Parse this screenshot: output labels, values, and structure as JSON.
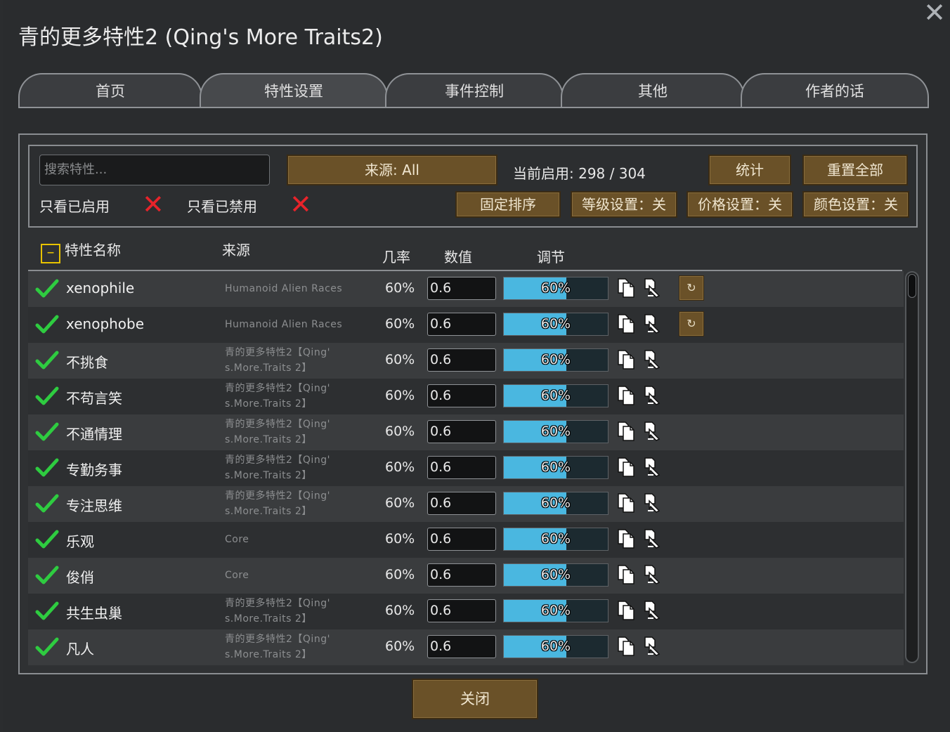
{
  "window": {
    "title": "青的更多特性2 (Qing's More Traits2)",
    "close_glyph": "✕"
  },
  "tabs": [
    {
      "label": "首页"
    },
    {
      "label": "特性设置"
    },
    {
      "label": "事件控制"
    },
    {
      "label": "其他"
    },
    {
      "label": "作者的话"
    }
  ],
  "active_tab": "特性设置",
  "toolbar": {
    "search_placeholder": "搜索特性...",
    "source_button": "来源: All",
    "enabled_count": "当前启用: 298 / 304",
    "stats_button": "统计",
    "reset_all_button": "重置全部",
    "only_enabled_label": "只看已启用",
    "only_disabled_label": "只看已禁用",
    "only_enabled_checked": false,
    "only_disabled_checked": false,
    "fixed_sort_button": "固定排序",
    "level_setting_button": "等级设置：关",
    "price_setting_button": "价格设置：关",
    "color_setting_button": "颜色设置：关"
  },
  "table": {
    "collapse_glyph": "–",
    "headers": {
      "name": "特性名称",
      "source": "来源",
      "rate": "几率",
      "value": "数值",
      "adjust": "调节"
    },
    "rows": [
      {
        "name": "xenophile",
        "source": [
          "Humanoid Alien Races"
        ],
        "rate": "60%",
        "value": "0.6",
        "progress": 0.6,
        "progress_label": "60%",
        "reset": true,
        "enabled": true
      },
      {
        "name": "xenophobe",
        "source": [
          "Humanoid Alien Races"
        ],
        "rate": "60%",
        "value": "0.6",
        "progress": 0.6,
        "progress_label": "60%",
        "reset": true,
        "enabled": true
      },
      {
        "name": "不挑食",
        "source": [
          "青的更多特性2【Qing'",
          "s.More.Traits 2】"
        ],
        "rate": "60%",
        "value": "0.6",
        "progress": 0.6,
        "progress_label": "60%",
        "reset": false,
        "enabled": true
      },
      {
        "name": "不苟言笑",
        "source": [
          "青的更多特性2【Qing'",
          "s.More.Traits 2】"
        ],
        "rate": "60%",
        "value": "0.6",
        "progress": 0.6,
        "progress_label": "60%",
        "reset": false,
        "enabled": true
      },
      {
        "name": "不通情理",
        "source": [
          "青的更多特性2【Qing'",
          "s.More.Traits 2】"
        ],
        "rate": "60%",
        "value": "0.6",
        "progress": 0.6,
        "progress_label": "60%",
        "reset": false,
        "enabled": true
      },
      {
        "name": "专勤务事",
        "source": [
          "青的更多特性2【Qing'",
          "s.More.Traits 2】"
        ],
        "rate": "60%",
        "value": "0.6",
        "progress": 0.6,
        "progress_label": "60%",
        "reset": false,
        "enabled": true
      },
      {
        "name": "专注思维",
        "source": [
          "青的更多特性2【Qing'",
          "s.More.Traits 2】"
        ],
        "rate": "60%",
        "value": "0.6",
        "progress": 0.6,
        "progress_label": "60%",
        "reset": false,
        "enabled": true
      },
      {
        "name": "乐观",
        "source": [
          "Core"
        ],
        "rate": "60%",
        "value": "0.6",
        "progress": 0.6,
        "progress_label": "60%",
        "reset": false,
        "enabled": true
      },
      {
        "name": "俊俏",
        "source": [
          "Core"
        ],
        "rate": "60%",
        "value": "0.6",
        "progress": 0.6,
        "progress_label": "60%",
        "reset": false,
        "enabled": true
      },
      {
        "name": "共生虫巢",
        "source": [
          "青的更多特性2【Qing'",
          "s.More.Traits 2】"
        ],
        "rate": "60%",
        "value": "0.6",
        "progress": 0.6,
        "progress_label": "60%",
        "reset": false,
        "enabled": true
      },
      {
        "name": "凡人",
        "source": [
          "青的更多特性2【Qing'",
          "s.More.Traits 2】"
        ],
        "rate": "60%",
        "value": "0.6",
        "progress": 0.6,
        "progress_label": "60%",
        "reset": false,
        "enabled": true
      }
    ],
    "reset_glyph": "↻"
  },
  "footer": {
    "close_button": "关闭"
  },
  "colors": {
    "accent_blue": "#4ab7e0",
    "button_brown": "#6a5128",
    "check_green": "#2ecc40",
    "red_x": "#e8232a",
    "highlight_yellow": "#e8c300"
  }
}
